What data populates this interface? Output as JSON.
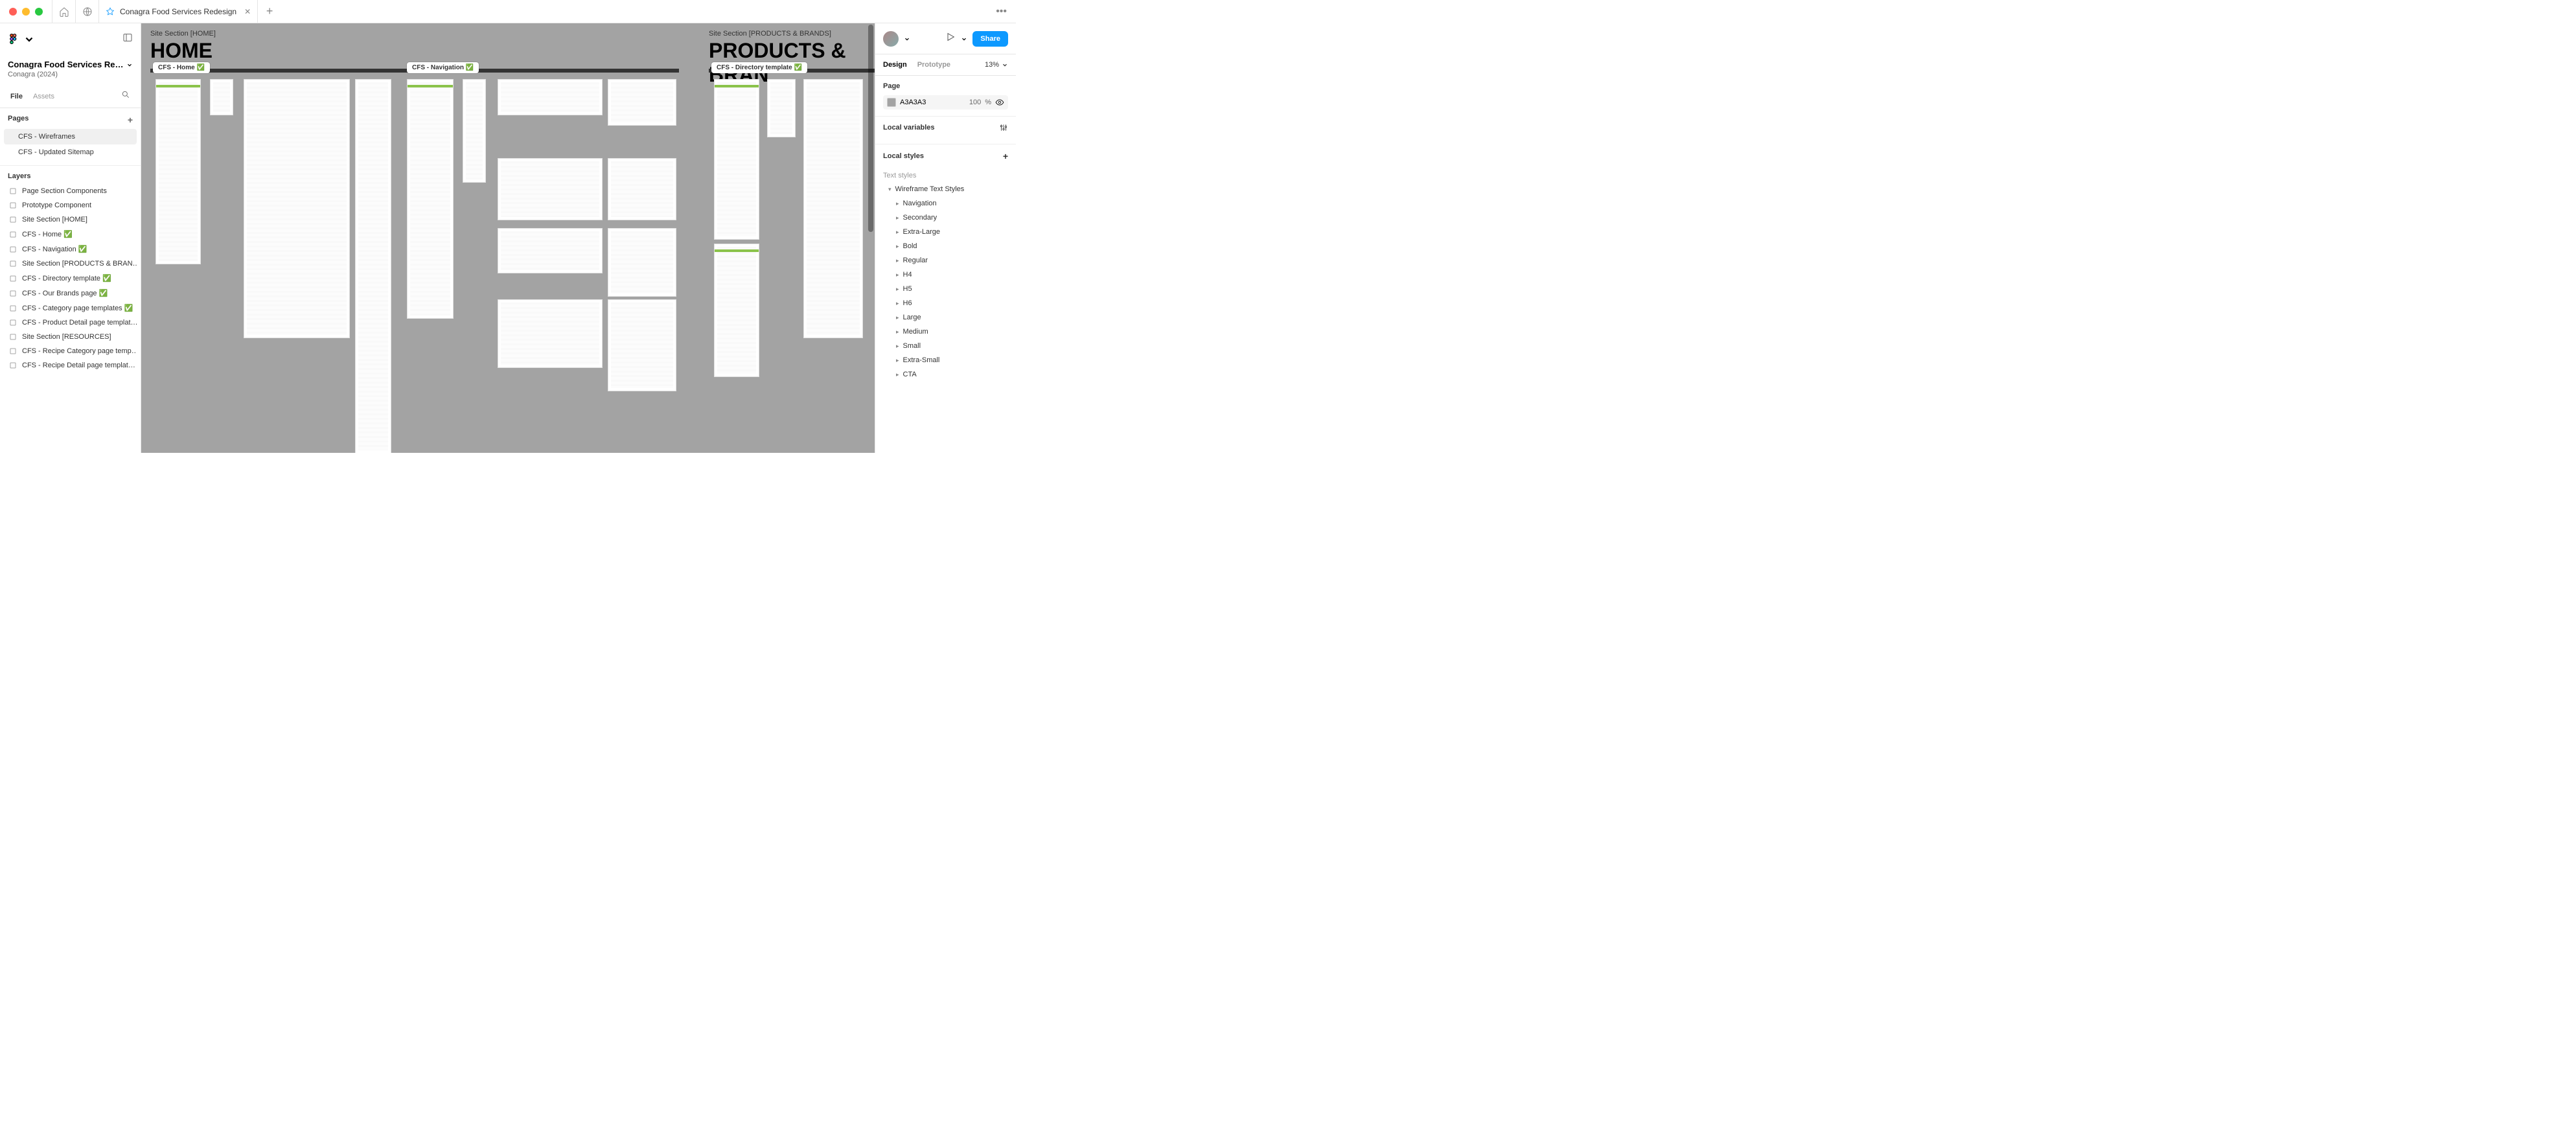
{
  "titlebar": {
    "tab_title": "Conagra Food Services Redesign",
    "menu_dots": "•••"
  },
  "left": {
    "project_title": "Conagra Food Services Re…",
    "project_sub": "Conagra (2024)",
    "tab_file": "File",
    "tab_assets": "Assets",
    "pages_label": "Pages",
    "pages": [
      {
        "label": "CFS - Wireframes",
        "active": true
      },
      {
        "label": "CFS - Updated Sitemap",
        "active": false
      }
    ],
    "layers_label": "Layers",
    "layers": [
      "Page Section Components",
      "Prototype Component",
      "Site Section [HOME]",
      "CFS - Home ✅",
      "CFS - Navigation ✅",
      "Site Section [PRODUCTS & BRAN…",
      "CFS - Directory template ✅",
      "CFS - Our Brands page ✅",
      "CFS - Category page templates ✅",
      "CFS - Product Detail page templat…",
      "Site Section [RESOURCES]",
      "CFS - Recipe Category page temp…",
      "CFS - Recipe Detail page templat…"
    ]
  },
  "canvas": {
    "section1_label": "Site Section [HOME]",
    "section1_title": "HOME",
    "section2_label": "Site Section [PRODUCTS & BRANDS]",
    "section2_title": "PRODUCTS & BRAN",
    "frame_home": "CFS - Home ✅",
    "frame_nav": "CFS - Navigation ✅",
    "frame_dir": "CFS - Directory template ✅"
  },
  "right": {
    "share": "Share",
    "tab_design": "Design",
    "tab_prototype": "Prototype",
    "zoom": "13%",
    "page_label": "Page",
    "bg_hex": "A3A3A3",
    "bg_opacity": "100",
    "bg_unit": "%",
    "local_vars": "Local variables",
    "local_styles": "Local styles",
    "text_styles": "Text styles",
    "group_name": "Wireframe Text Styles",
    "styles": [
      "Navigation",
      "Secondary",
      "Extra-Large",
      "Bold",
      "Regular",
      "H4",
      "H5",
      "H6",
      "Large",
      "Medium",
      "Small",
      "Extra-Small",
      "CTA"
    ]
  }
}
